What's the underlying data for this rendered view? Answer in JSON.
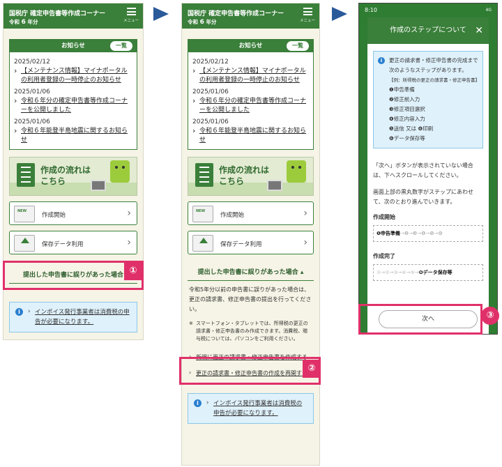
{
  "screen1": {
    "header": {
      "title": "国税庁 確定申告書等作成コーナー",
      "year_pre": "令和",
      "year_num": "6",
      "year_post": "年分",
      "menu_label": "メニュー"
    },
    "news": {
      "heading": "お知らせ",
      "all_button": "一覧",
      "items": [
        {
          "date": "2025/02/12",
          "text": "【メンテナンス情報】マイナポータルの利用者登録の一時停止のお知らせ"
        },
        {
          "date": "2025/01/06",
          "text": "令和６年分の確定申告書等作成コーナーを公開しました"
        },
        {
          "date": "2025/01/06",
          "text": "令和６年能登半島地震に関するお知らせ"
        }
      ]
    },
    "flow_banner": "作成の流れは\nこちら",
    "start_button": "作成開始",
    "saved_button": "保存データ利用",
    "mistake_title": "提出した申告書に誤りがあった場合",
    "invoice_text": "インボイス発行事業者は消費税の申告が必要になります。"
  },
  "screen2": {
    "mistake_title": "提出した申告書に誤りがあった場合",
    "desc": "令和5年分以前の申告書に誤りがあった場合は、更正の請求書、修正申告書の提出を行ってください。",
    "note": "スマートフォン・タブレットでは、所得税の更正の請求書・修正申告書のみ作成できます。消費税、贈与税については、パソコンをご利用ください。",
    "link_new": "新規に更正の請求書・修正申告書を作成する",
    "link_resume": "更正の請求書・修正申告書の作成を再開する"
  },
  "screen3": {
    "status_time": "8:10",
    "status_right": "4G",
    "modal_title": "作成のステップについて",
    "info_intro": "更正の請求書・修正申告書の完成まで次のようなステップがあります。",
    "info_example": "【例：所得税の更正の請求書・修正申告書】",
    "steps": [
      "❶申告準備",
      "❷修正前入力",
      "❸修正項目選択",
      "❹修正内容入力",
      "❺送信 又は ❻印刷",
      "❻データ保存等"
    ],
    "para1": "「次へ」ボタンが表示されていない場合は、下へスクロールしてください。",
    "para2": "画面上部の黒丸数字がステップにあわせて、次のとおり進んでいきます。",
    "start_label": "作成開始",
    "start_row_on": "❶申告準備",
    "start_row_off": "→❷→❸→❹→❺→❻",
    "end_label": "作成完了",
    "end_row_off": "①→②→③→④→⑤→",
    "end_row_on": "❻データ保存等",
    "next_button": "次へ"
  },
  "markers": {
    "m1": "①",
    "m2": "②",
    "m3": "③"
  },
  "colors": {
    "header_green": "#3a7f3a",
    "highlight": "#e0306a",
    "arrow": "#2a5a9a",
    "info_bg": "#dff1fb"
  }
}
